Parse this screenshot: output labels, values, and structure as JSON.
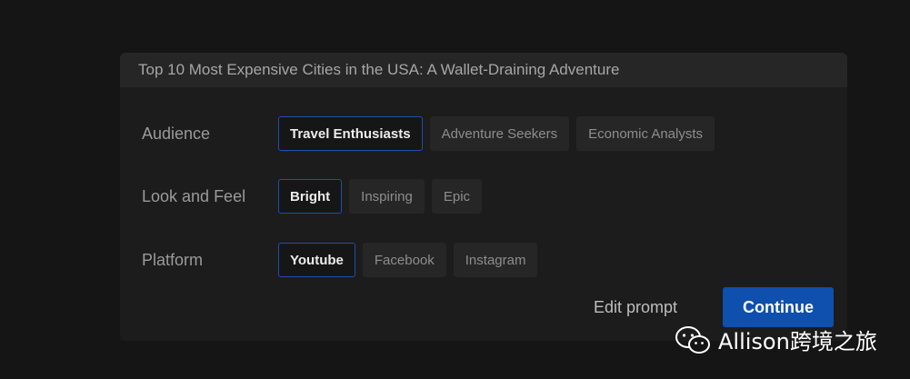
{
  "panel": {
    "title": "Top 10 Most Expensive Cities in the USA: A Wallet-Draining Adventure"
  },
  "rows": [
    {
      "label": "Audience",
      "options": [
        "Travel Enthusiasts",
        "Adventure Seekers",
        "Economic Analysts"
      ],
      "selected": "Travel Enthusiasts"
    },
    {
      "label": "Look and Feel",
      "options": [
        "Bright",
        "Inspiring",
        "Epic"
      ],
      "selected": "Bright"
    },
    {
      "label": "Platform",
      "options": [
        "Youtube",
        "Facebook",
        "Instagram"
      ],
      "selected": "Youtube"
    }
  ],
  "actions": {
    "edit_label": "Edit prompt",
    "continue_label": "Continue"
  },
  "watermark": {
    "icon": "wechat-icon",
    "text": "Allison跨境之旅"
  },
  "colors": {
    "accent": "#0f4fad",
    "selected_border": "#1e4fb0",
    "background": "#151515",
    "panel": "#1c1c1c"
  }
}
